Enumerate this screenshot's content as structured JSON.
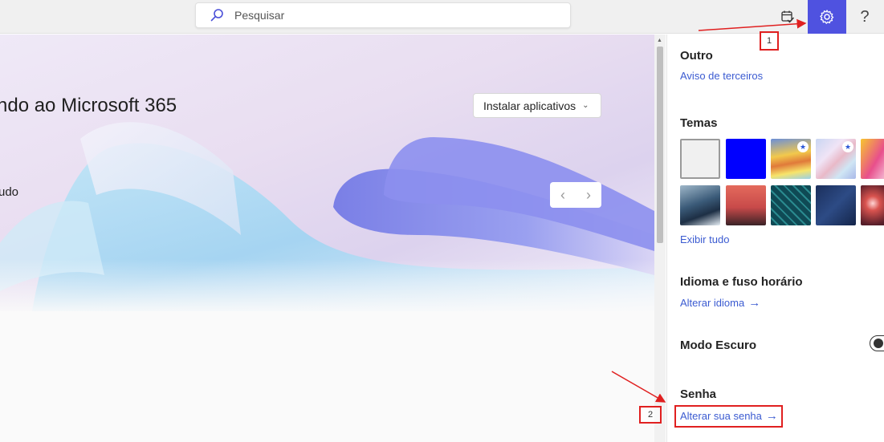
{
  "search": {
    "placeholder": "Pesquisar"
  },
  "toolbar": {
    "todo_icon": "calendar-check-icon",
    "settings_icon": "gear-icon",
    "help_label": "?"
  },
  "hero": {
    "welcome": "ndo ao Microsoft 365",
    "sub": "udo",
    "install_label": "Instalar aplicativos",
    "prev": "‹",
    "next": "›"
  },
  "settings": {
    "other": {
      "title": "Outro",
      "link": "Aviso de terceiros"
    },
    "themes": {
      "title": "Temas",
      "view_all": "Exibir tudo"
    },
    "language": {
      "title": "Idioma e fuso horário",
      "link": "Alterar idioma"
    },
    "dark_mode": {
      "title": "Modo Escuro",
      "on": true
    },
    "password": {
      "title": "Senha",
      "link": "Alterar sua senha"
    }
  },
  "annotations": {
    "step1": "1",
    "step2": "2"
  },
  "colors": {
    "accent": "#4f52e0",
    "link": "#3b5bd1",
    "annotation": "#e02020"
  }
}
